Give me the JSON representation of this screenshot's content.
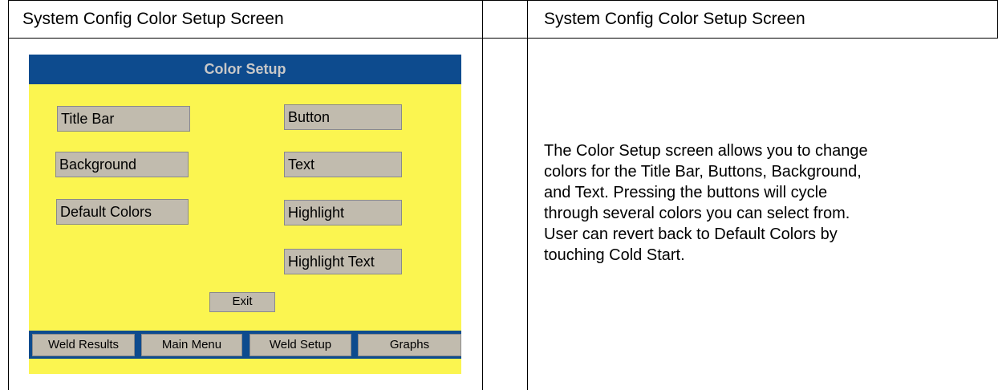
{
  "header": {
    "left_title": "System Config Color Setup Screen",
    "right_title": "System Config Color Setup Screen"
  },
  "screen": {
    "title": "Color Setup",
    "buttons": {
      "title_bar": "Title Bar",
      "button": "Button",
      "background": "Background",
      "text": "Text",
      "default_colors": "Default Colors",
      "highlight": "Highlight",
      "highlight_text": "Highlight Text",
      "exit": "Exit"
    },
    "nav": {
      "weld_results": "Weld Results",
      "main_menu": "Main Menu",
      "weld_setup": "Weld Setup",
      "graphs": "Graphs"
    },
    "colors": {
      "background": "#fbf550",
      "title_bar": "#0d4b8e",
      "button": "#c1bbae",
      "title_text": "#c8c8c8"
    }
  },
  "description": {
    "lines": [
      "The Color Setup screen allows you to change",
      "colors for the Title Bar, Buttons, Background,",
      "and Text. Pressing the buttons will cycle",
      "through several colors you can select from.",
      "User can revert back to Default Colors by",
      "touching Cold Start."
    ]
  }
}
